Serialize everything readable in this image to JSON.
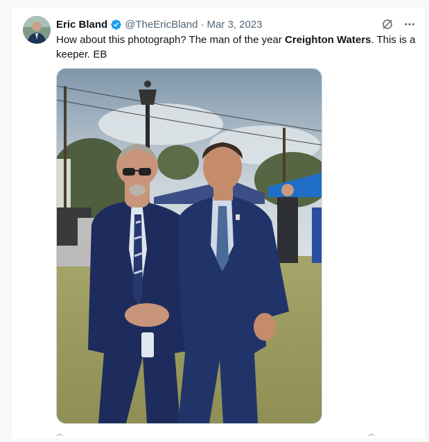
{
  "tweet": {
    "author_name": "Eric Bland",
    "handle": "@TheEricBland",
    "separator": "·",
    "date": "Mar 3, 2023",
    "verified": true,
    "text_part1": "How about this photograph? The man of the year ",
    "text_bold": "Creighton Waters",
    "text_part2": ". This is a keeper. EB",
    "media": "photo-two-men-in-suits-outdoors"
  },
  "colors": {
    "verified_badge": "#1d9bf0",
    "text": "#0f1419",
    "secondary": "#536471"
  },
  "icons": [
    "avatar",
    "verified-icon",
    "grok-icon",
    "more-icon",
    "reply-icon",
    "share-icon"
  ]
}
